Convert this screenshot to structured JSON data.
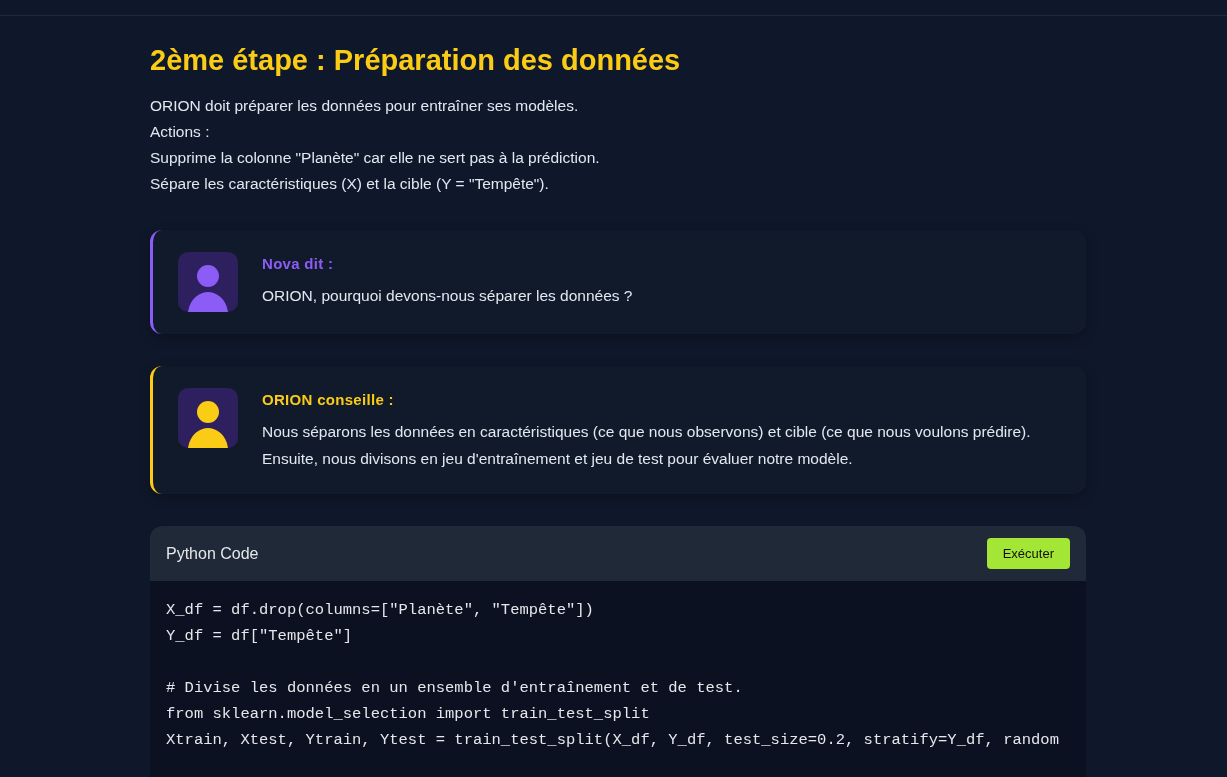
{
  "title": "2ème étape : Préparation des données",
  "intro": [
    "ORION doit préparer les données pour entraîner ses modèles.",
    "Actions :",
    "Supprime la colonne \"Planète\" car elle ne sert pas à la prédiction.",
    "Sépare les caractéristiques (X) et la cible (Y = \"Tempête\")."
  ],
  "dialogs": [
    {
      "speaker": "Nova dit :",
      "color": "#8b5cf6",
      "text": "ORION, pourquoi devons-nous séparer les données ?"
    },
    {
      "speaker": "ORION conseille :",
      "color": "#facc15",
      "text": "Nous séparons les données en caractéristiques (ce que nous observons) et cible (ce que nous voulons prédire). Ensuite, nous divisons en jeu d'entraînement et jeu de test pour évaluer notre modèle."
    }
  ],
  "code_panel": {
    "title": "Python Code",
    "button": "Exécuter",
    "blocks": [
      [
        "X_df = df.drop(columns=[\"Planète\", \"Tempête\"])",
        "Y_df = df[\"Tempête\"]"
      ],
      [
        "# Divise les données en un ensemble d'entraînement et de test.",
        "from sklearn.model_selection import train_test_split",
        "Xtrain, Xtest, Ytrain, Ytest = train_test_split(X_df, Y_df, test_size=0.2, stratify=Y_df, random"
      ]
    ]
  }
}
